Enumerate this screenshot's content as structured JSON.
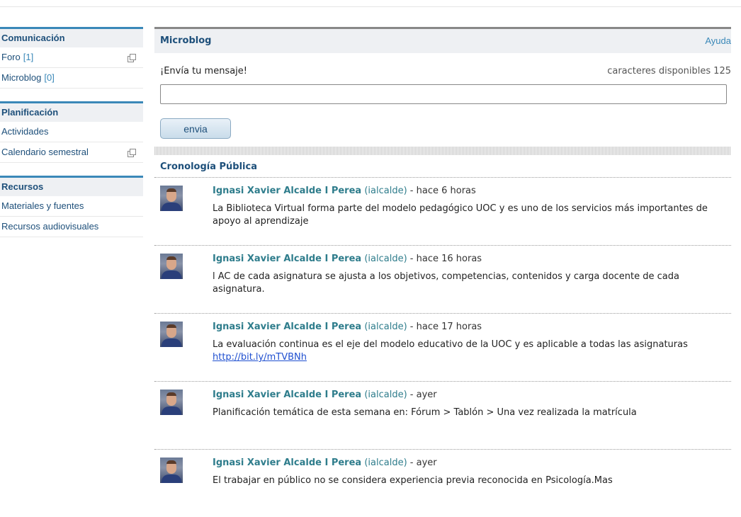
{
  "sidebar": {
    "sections": [
      {
        "title": "Comunicación",
        "items": [
          {
            "label": "Foro",
            "count": "[1]",
            "popup": true
          },
          {
            "label": "Microblog",
            "count": "[0]",
            "popup": false
          }
        ]
      },
      {
        "title": "Planificación",
        "items": [
          {
            "label": "Actividades",
            "count": "",
            "popup": false
          },
          {
            "label": "Calendario semestral",
            "count": "",
            "popup": true
          }
        ]
      },
      {
        "title": "Recursos",
        "items": [
          {
            "label": "Materiales y fuentes",
            "count": "",
            "popup": false
          },
          {
            "label": "Recursos audiovisuales",
            "count": "",
            "popup": false
          }
        ]
      }
    ]
  },
  "microblog": {
    "title": "Microblog",
    "help_label": "Ayuda",
    "send_label": "¡Envía tu mensaje!",
    "chars_label": "caracteres disponibles",
    "chars_value": "125",
    "input_value": "",
    "send_button": "envia",
    "timeline_title": "Cronología Pública"
  },
  "posts": [
    {
      "author": "Ignasi Xavier Alcalde I Perea",
      "handle": "(ialcalde)",
      "time": "hace 6 horas",
      "text": "La Biblioteca Virtual forma parte del modelo pedagógico UOC y es uno de los servicios más importantes de apoyo al aprendizaje",
      "link": ""
    },
    {
      "author": "Ignasi Xavier Alcalde I Perea",
      "handle": "(ialcalde)",
      "time": "hace 16 horas",
      "text": "l AC de cada asignatura se ajusta a los objetivos, competencias, contenidos y carga docente de cada asignatura.",
      "link": ""
    },
    {
      "author": "Ignasi Xavier Alcalde I Perea",
      "handle": "(ialcalde)",
      "time": "hace 17 horas",
      "text": "La evaluación continua es el eje del modelo educativo de la UOC y es aplicable a todas las asignaturas",
      "link": "http://bit.ly/mTVBNh"
    },
    {
      "author": "Ignasi Xavier Alcalde I Perea",
      "handle": "(ialcalde)",
      "time": "ayer",
      "text": "Planificación temática de esta semana en: Fórum > Tablón > Una vez realizada la matrícula",
      "link": ""
    },
    {
      "author": "Ignasi Xavier Alcalde I Perea",
      "handle": "(ialcalde)",
      "time": "ayer",
      "text": "El trabajar en público no se considera experiencia previa reconocida en Psicología.Mas",
      "link": ""
    }
  ]
}
